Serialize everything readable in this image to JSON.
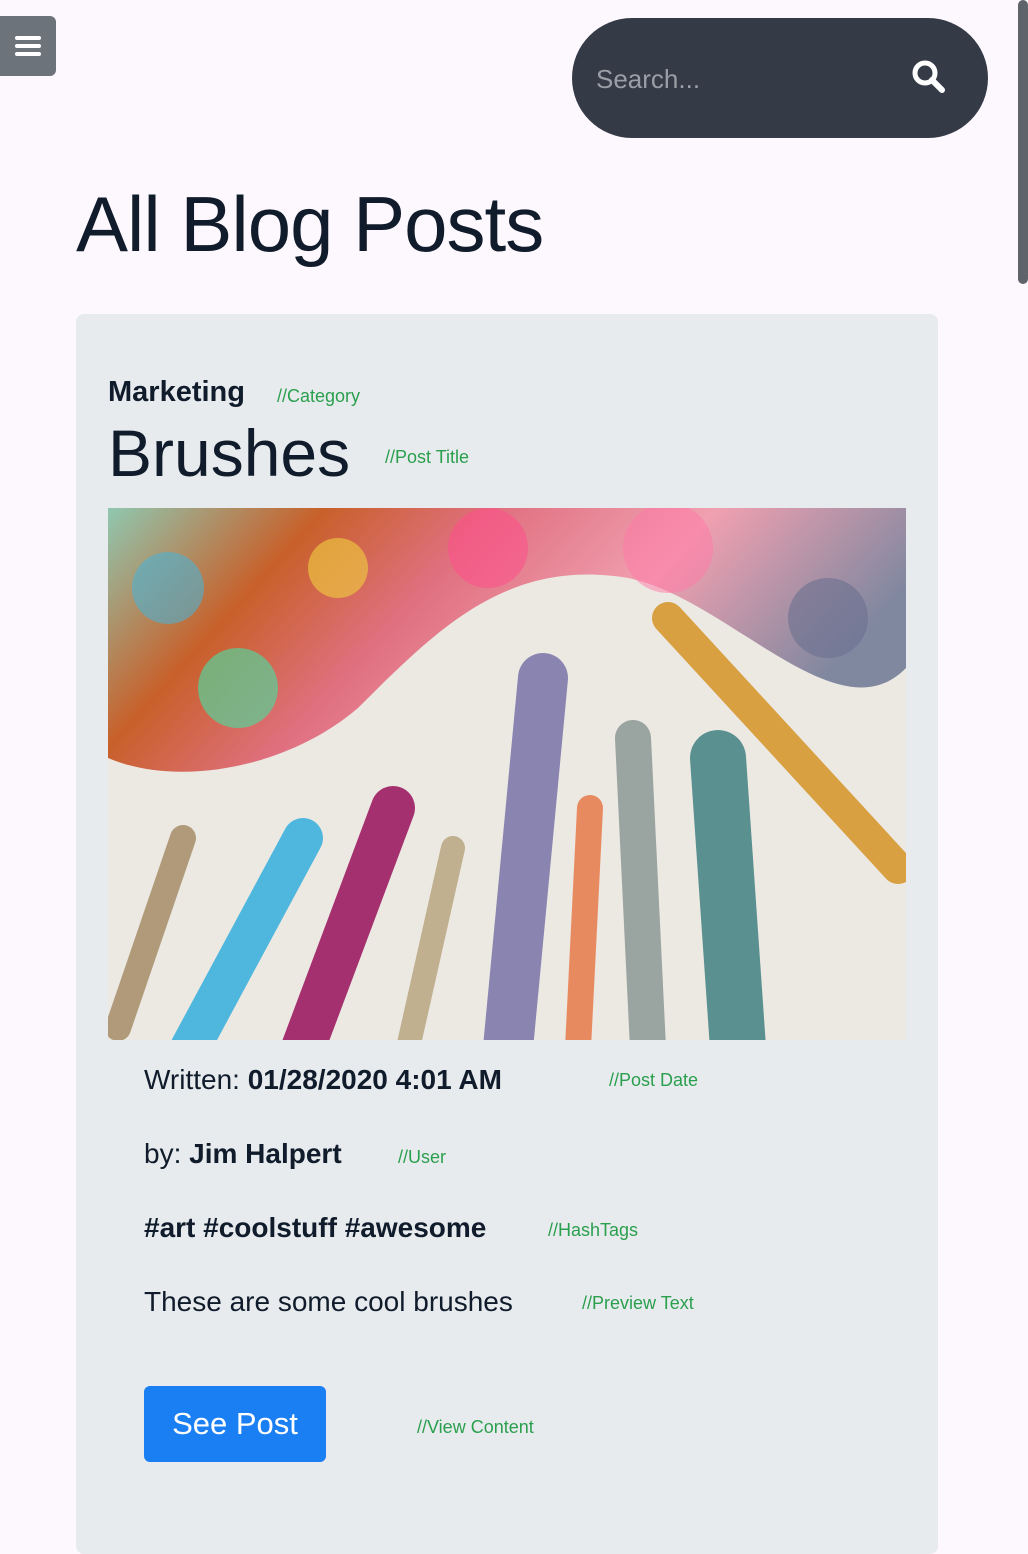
{
  "search": {
    "placeholder": "Search..."
  },
  "page": {
    "title": "All Blog Posts"
  },
  "post": {
    "category": "Marketing",
    "category_comment": "//Category",
    "title": "Brushes",
    "title_comment": "//Post Title",
    "date_label": "Written: ",
    "date": "01/28/2020 4:01 AM",
    "date_comment": "//Post Date",
    "user_label": "by: ",
    "user": "Jim Halpert",
    "user_comment": "//User",
    "hashtags": "#art #coolstuff #awesome",
    "hashtags_comment": "//HashTags",
    "preview": "These are some cool brushes",
    "preview_comment": "//Preview Text",
    "button_label": "See Post",
    "button_comment": "//View Content"
  },
  "colors": {
    "background": "#fdf8fd",
    "search_bg": "#343a46",
    "card_bg": "#e8ebee",
    "button_bg": "#1b7ff4",
    "comment": "#2a9f4e",
    "menu_bg": "#6c737a"
  },
  "icons": {
    "menu": "hamburger-icon",
    "search": "search-icon"
  }
}
